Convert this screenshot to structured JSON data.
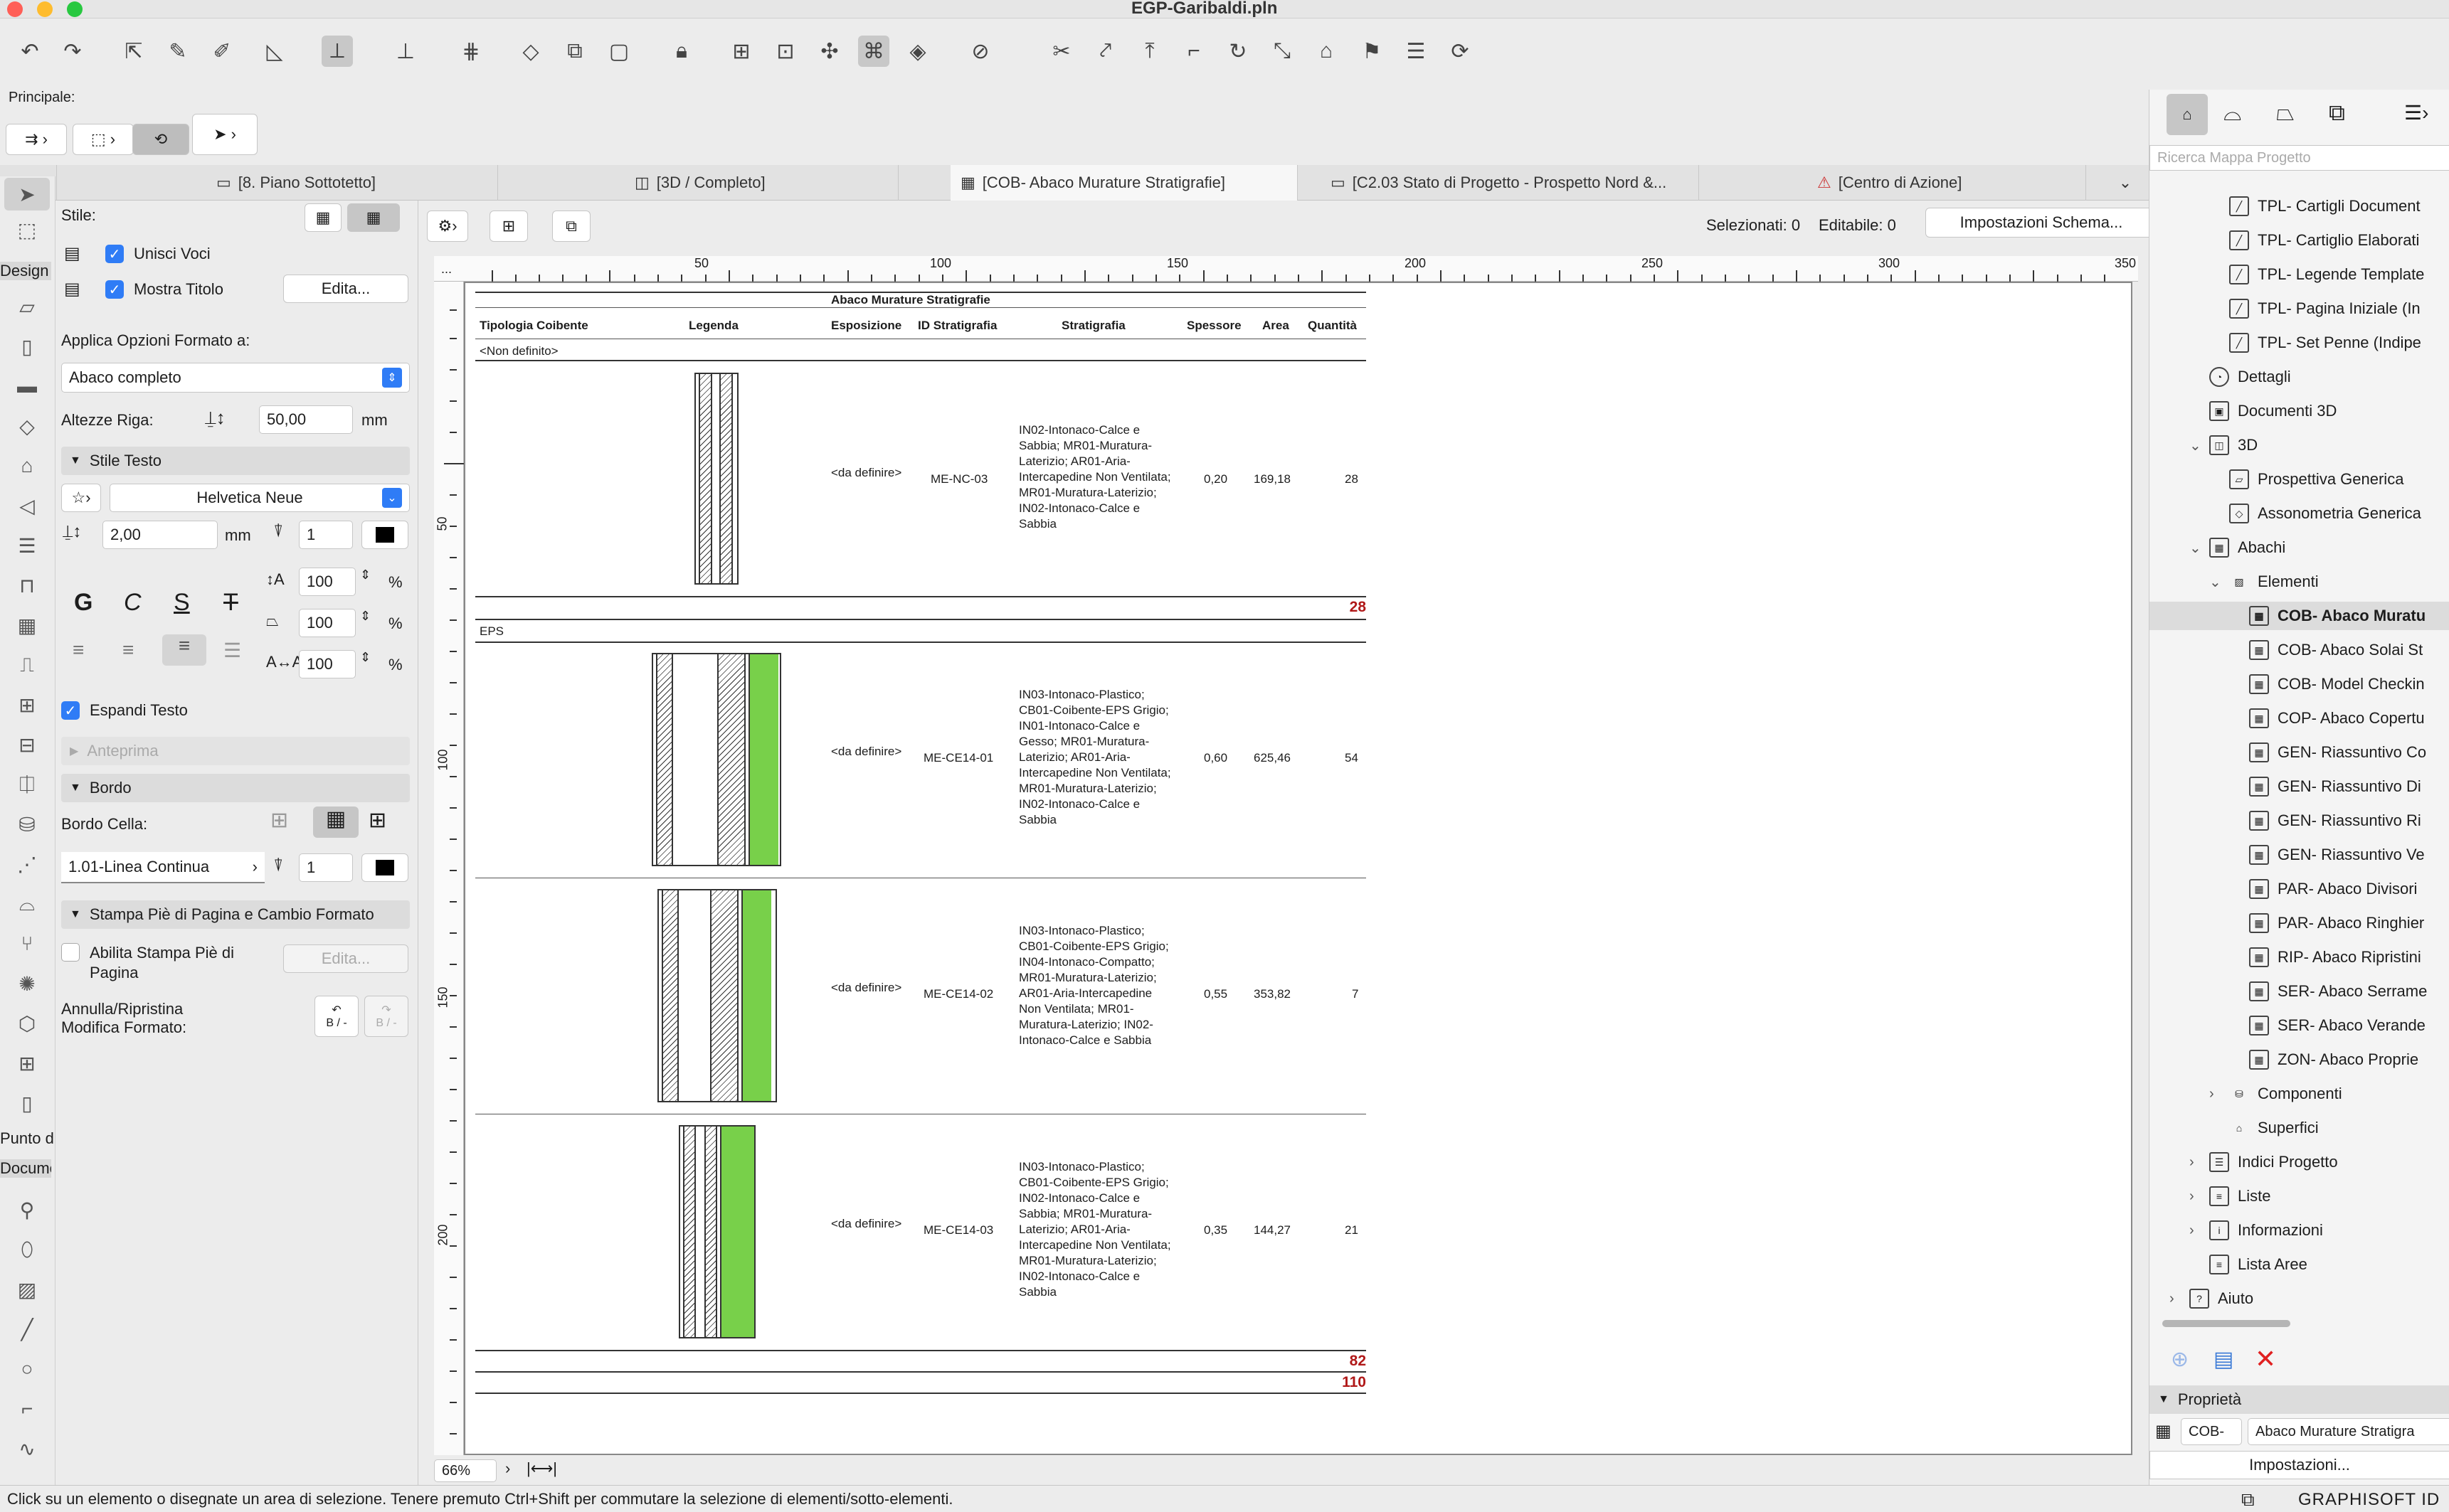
{
  "window": {
    "title": "EGP-Garibaldi.pln"
  },
  "toolbar": {
    "principale_label": "Principale:"
  },
  "tabs": [
    {
      "label": "[8. Piano Sottotetto]",
      "icon": "floor-plan-icon"
    },
    {
      "label": "[3D / Completo]",
      "icon": "3d-view-icon"
    },
    {
      "label": "[COB- Abaco Murature Stratigrafie]",
      "icon": "schedule-icon"
    },
    {
      "label": "[C2.03 Stato di Progetto - Prospetto Nord &...",
      "icon": "layout-icon"
    },
    {
      "label": "[Centro di Azione]",
      "icon": "action-center-icon"
    }
  ],
  "toolbox": {
    "design_label": "Design",
    "punto_label": "Punto d",
    "docum_label": "Docume"
  },
  "infobox": {
    "stile_label": "Stile:",
    "unisci_voci": "Unisci Voci",
    "mostra_titolo": "Mostra Titolo",
    "edita_button": "Edita...",
    "applica_label": "Applica Opzioni Formato a:",
    "applica_value": "Abaco completo",
    "altezze_label": "Altezze Riga:",
    "altezze_value": "50,00",
    "altezze_unit": "mm",
    "stile_testo": "Stile Testo",
    "font_value": "Helvetica Neue",
    "font_size": "2,00",
    "font_unit": "mm",
    "pen_value": "1",
    "pct_1": "100",
    "pct_2": "100",
    "pct_3": "100",
    "pct_sign": "%",
    "bold_glyph": "G",
    "italic_glyph": "C",
    "underline_glyph": "S",
    "strike_glyph": "T",
    "espandi_testo": "Espandi Testo",
    "anteprima": "Anteprima",
    "bordo": "Bordo",
    "bordo_cella": "Bordo Cella:",
    "linea_value": "1.01-Linea Continua",
    "linea_pen": "1",
    "stampa_section": "Stampa Piè di Pagina e Cambio Formato",
    "abilita_stampa": "Abilita Stampa Piè di Pagina",
    "edita_disabled": "Edita...",
    "annulla_label": "Annulla/Ripristina Modifica Formato:",
    "undo_glyph": "B / -",
    "redo_glyph": "B / -"
  },
  "viewhead": {
    "selezionati": "Selezionati: 0",
    "editabile": "Editabile: 0",
    "impostazioni_button": "Impostazioni Schema..."
  },
  "ruler": {
    "h_labels": [
      "50",
      "100",
      "150",
      "200",
      "250",
      "300",
      "350"
    ],
    "v_labels": [
      "50",
      "100",
      "150",
      "200"
    ],
    "ellipsis": "..."
  },
  "schedule": {
    "title": "Abaco Murature Stratigrafie",
    "headers": [
      "Tipologia Coibente",
      "Legenda",
      "Esposizione",
      "ID Stratigrafia",
      "Stratigrafia",
      "Spessore",
      "Area",
      "Quantità"
    ],
    "groups": [
      {
        "name": "<Non definito>",
        "rows": [
          {
            "esposizione": "<da definire>",
            "id": "ME-NC-03",
            "stratigrafia": "IN02-Intonaco-Calce e Sabbia; MR01-Muratura-Laterizio; AR01-Aria-Intercapedine Non Ventilata; MR01-Muratura-Laterizio; IN02-Intonaco-Calce e Sabbia",
            "spessore": "0,20",
            "area": "169,18",
            "quantita": "28"
          }
        ],
        "subtotal": "28"
      },
      {
        "name": "EPS",
        "rows": [
          {
            "esposizione": "<da definire>",
            "id": "ME-CE14-01",
            "stratigrafia": "IN03-Intonaco-Plastico; CB01-Coibente-EPS Grigio; IN01-Intonaco-Calce e Gesso; MR01-Muratura-Laterizio; AR01-Aria-Intercapedine Non Ventilata; MR01-Muratura-Laterizio; IN02-Intonaco-Calce e Sabbia",
            "spessore": "0,60",
            "area": "625,46",
            "quantita": "54"
          },
          {
            "esposizione": "<da definire>",
            "id": "ME-CE14-02",
            "stratigrafia": "IN03-Intonaco-Plastico; CB01-Coibente-EPS Grigio; IN04-Intonaco-Compatto; MR01-Muratura-Laterizio; AR01-Aria-Intercapedine Non Ventilata; MR01-Muratura-Laterizio; IN02-Intonaco-Calce e Sabbia",
            "spessore": "0,55",
            "area": "353,82",
            "quantita": "7"
          },
          {
            "esposizione": "<da definire>",
            "id": "ME-CE14-03",
            "stratigrafia": "IN03-Intonaco-Plastico; CB01-Coibente-EPS Grigio; IN02-Intonaco-Calce e Sabbia; MR01-Muratura-Laterizio; AR01-Aria-Intercapedine Non Ventilata; MR01-Muratura-Laterizio; IN02-Intonaco-Calce e Sabbia",
            "spessore": "0,35",
            "area": "144,27",
            "quantita": "21"
          }
        ],
        "subtotal": "82"
      }
    ],
    "grand_total": "110"
  },
  "rightpanel": {
    "search_placeholder": "Ricerca Mappa Progetto",
    "tree": [
      {
        "label": "TPL- Cartigli Document",
        "icon": "layout-icon"
      },
      {
        "label": "TPL- Cartiglio Elaborati",
        "icon": "layout-icon"
      },
      {
        "label": "TPL- Legende Template",
        "icon": "layout-icon"
      },
      {
        "label": "TPL- Pagina Iniziale (In",
        "icon": "layout-icon"
      },
      {
        "label": "TPL- Set Penne (Indipe",
        "icon": "layout-icon"
      },
      {
        "label": "Dettagli",
        "icon": "details-icon"
      },
      {
        "label": "Documenti 3D",
        "icon": "document-3d-icon"
      },
      {
        "label": "3D",
        "icon": "3d-icon"
      },
      {
        "label": "Prospettiva Generica",
        "icon": "perspective-icon"
      },
      {
        "label": "Assonometria Generica",
        "icon": "axonometry-icon"
      },
      {
        "label": "Abachi",
        "icon": "schedule-icon"
      },
      {
        "label": "Elementi",
        "icon": "elements-icon"
      },
      {
        "label": "COB- Abaco Muratu",
        "icon": "schedule-icon"
      },
      {
        "label": "COB- Abaco Solai St",
        "icon": "schedule-icon"
      },
      {
        "label": "COB- Model Checkin",
        "icon": "schedule-icon"
      },
      {
        "label": "COP- Abaco Copertu",
        "icon": "schedule-icon"
      },
      {
        "label": "GEN- Riassuntivo Co",
        "icon": "schedule-icon"
      },
      {
        "label": "GEN- Riassuntivo Di",
        "icon": "schedule-icon"
      },
      {
        "label": "GEN- Riassuntivo Ri",
        "icon": "schedule-icon"
      },
      {
        "label": "GEN- Riassuntivo Ve",
        "icon": "schedule-icon"
      },
      {
        "label": "PAR- Abaco Divisori",
        "icon": "schedule-icon"
      },
      {
        "label": "PAR- Abaco Ringhier",
        "icon": "schedule-icon"
      },
      {
        "label": "RIP- Abaco Ripristini",
        "icon": "schedule-icon"
      },
      {
        "label": "SER- Abaco Serrame",
        "icon": "schedule-icon"
      },
      {
        "label": "SER- Abaco Verande",
        "icon": "schedule-icon"
      },
      {
        "label": "ZON- Abaco Proprie",
        "icon": "schedule-icon"
      },
      {
        "label": "Componenti",
        "icon": "components-icon"
      },
      {
        "label": "Superfici",
        "icon": "surfaces-icon"
      },
      {
        "label": "Indici Progetto",
        "icon": "index-icon"
      },
      {
        "label": "Liste",
        "icon": "list-icon"
      },
      {
        "label": "Informazioni",
        "icon": "info-icon"
      },
      {
        "label": "Lista Aree",
        "icon": "area-list-icon"
      },
      {
        "label": "Aiuto",
        "icon": "help-icon"
      }
    ],
    "proprieta": "Proprietà",
    "prop_short": "COB-",
    "prop_name": "Abaco Murature Stratigra",
    "impostazioni": "Impostazioni..."
  },
  "zoom": {
    "value": "66%"
  },
  "status": {
    "message": "Click su un elemento o disegnate un area di selezione. Tenere premuto Ctrl+Shift per commutare la selezione di elementi/sotto-elementi.",
    "brand": "GRAPHISOFT ID"
  },
  "colors": {
    "accent": "#2f7cf6",
    "insulation": "#78d04a",
    "total": "#b01818"
  }
}
